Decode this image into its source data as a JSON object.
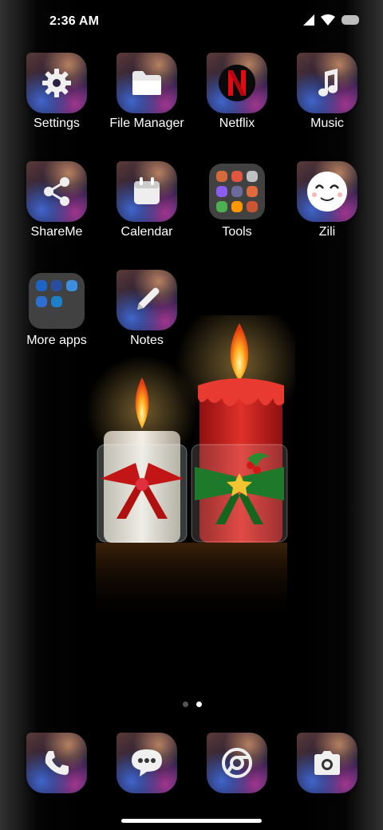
{
  "status_bar": {
    "time": "2:36 AM",
    "icons": [
      "signal-icon",
      "wifi-icon",
      "battery-icon"
    ]
  },
  "apps": [
    {
      "label": "Settings",
      "icon": "gear-icon"
    },
    {
      "label": "File Manager",
      "icon": "folder-icon"
    },
    {
      "label": "Netflix",
      "icon": "netflix-logo-icon"
    },
    {
      "label": "Music",
      "icon": "music-note-icon"
    },
    {
      "label": "ShareMe",
      "icon": "share-icon"
    },
    {
      "label": "Calendar",
      "icon": "calendar-icon"
    },
    {
      "label": "Tools",
      "icon": "folder-grid-icon"
    },
    {
      "label": "Zili",
      "icon": "smiley-face-icon"
    },
    {
      "label": "More apps",
      "icon": "folder-grid-icon"
    },
    {
      "label": "Notes",
      "icon": "pencil-icon"
    }
  ],
  "tools_folder_colors": [
    "#d46a3a",
    "#e0563e",
    "#c0c0c0",
    "#8b5cf6",
    "#6b6b9b",
    "#e06a3a",
    "#4caf50",
    "#ff9800",
    "#cc5533"
  ],
  "more_apps_folder_colors": [
    "#1e63c6",
    "#2a4e9e",
    "#3b8ee0",
    "#2d6fd0",
    "#1e80c8"
  ],
  "page_indicator": {
    "count": 2,
    "active": 2
  },
  "dock": [
    {
      "icon": "phone-icon"
    },
    {
      "icon": "messages-icon"
    },
    {
      "icon": "chrome-icon"
    },
    {
      "icon": "camera-icon"
    }
  ],
  "wallpaper": {
    "subject": "Christmas candles",
    "accent": "#d8261f"
  }
}
